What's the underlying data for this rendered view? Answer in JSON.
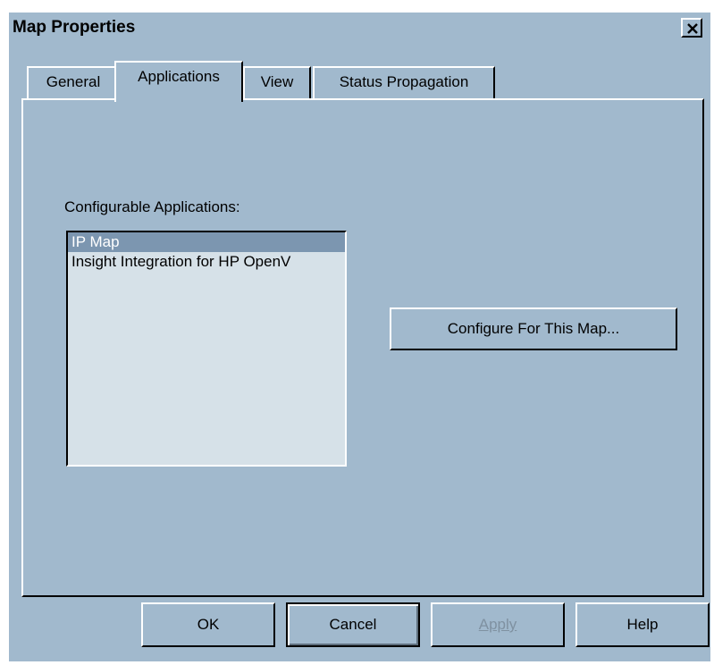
{
  "window": {
    "title": "Map Properties"
  },
  "tabs": [
    {
      "label": "General"
    },
    {
      "label": "Applications"
    },
    {
      "label": "View"
    },
    {
      "label": "Status Propagation"
    }
  ],
  "active_tab": "Applications",
  "applications_panel": {
    "section_label": "Configurable Applications:",
    "list_items": [
      {
        "label": "IP Map",
        "selected": true
      },
      {
        "label": "Insight Integration for HP OpenV",
        "selected": false
      }
    ],
    "configure_button_label": "Configure For This Map..."
  },
  "footer": {
    "ok_label": "OK",
    "cancel_label": "Cancel",
    "apply_label": "Apply",
    "help_label": "Help"
  },
  "icons": {
    "close": "close-icon"
  },
  "colors": {
    "window_bg": "#a1b9cd",
    "list_bg": "#d6e1e8",
    "selection": "#7c96b0"
  }
}
